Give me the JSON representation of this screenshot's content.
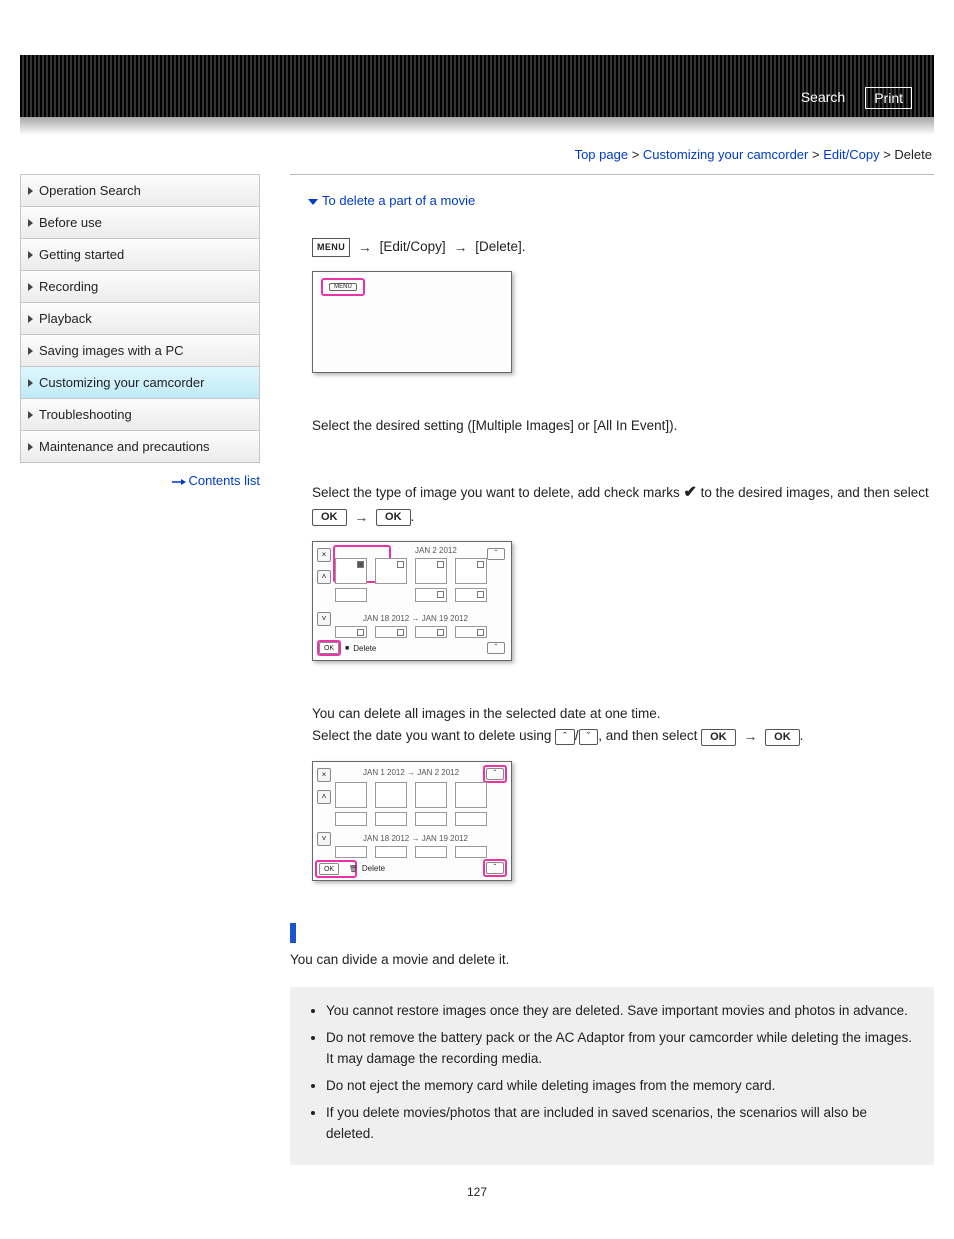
{
  "header": {
    "search_label": "Search",
    "print_label": "Print"
  },
  "breadcrumb": {
    "items": [
      "Top page",
      "Customizing your camcorder",
      "Edit/Copy"
    ],
    "current": "Delete"
  },
  "sidebar": {
    "items": [
      {
        "label": "Operation Search"
      },
      {
        "label": "Before use"
      },
      {
        "label": "Getting started"
      },
      {
        "label": "Recording"
      },
      {
        "label": "Playback"
      },
      {
        "label": "Saving images with a PC"
      },
      {
        "label": "Customizing your camcorder",
        "active": true
      },
      {
        "label": "Troubleshooting"
      },
      {
        "label": "Maintenance and precautions"
      }
    ],
    "contents_link": "Contents list"
  },
  "main": {
    "jump_link": "To delete a part of a movie",
    "menu_label": "MENU",
    "step1_bracket1": "[Edit/Copy]",
    "step1_bracket2": "[Delete].",
    "step2_text": "Select the desired setting ([Multiple Images] or [All In Event]).",
    "step3_pre": "Select the type of image you want to delete, add check marks ",
    "step3_mid": " to the desired images, and then select ",
    "step3_end": ".",
    "ok_label": "OK",
    "lcd2_top_date": "JAN 2 2012",
    "lcd2_mid_date": "JAN 18 2012 → JAN 19 2012",
    "lcd2_foot": "Delete",
    "step4_line1": "You can delete all images in the selected date at one time.",
    "step4_pre": "Select the date you want to delete using ",
    "step4_mid": ", and then select ",
    "step4_end": ".",
    "lcd3_top_date": "JAN 1 2012 → JAN 2 2012",
    "lcd3_mid_date": "JAN 18 2012 → JAN 19 2012",
    "lcd3_foot": "Delete",
    "section_text": "You can divide a movie and delete it.",
    "notes": [
      "You cannot restore images once they are deleted. Save important movies and photos in advance.",
      "Do not remove the battery pack or the AC Adaptor from your camcorder while deleting the images. It may damage the recording media.",
      "Do not eject the memory card while deleting images from the memory card.",
      "If you delete movies/photos that are included in saved scenarios, the scenarios will also be deleted."
    ]
  },
  "page_number": "127"
}
